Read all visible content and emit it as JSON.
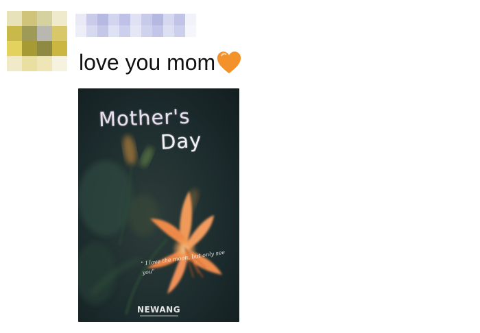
{
  "message": {
    "text": "love you mom",
    "emoji": "orange-heart-icon"
  },
  "poster": {
    "title_line1": "Mother's",
    "title_line2": "Day",
    "quote": "\" I love the moon, but only see you\"",
    "brand": "NEWANG"
  },
  "colors": {
    "heart": "#f3922a",
    "poster_bg": "#1b2a2c",
    "flower": "#f0915a"
  }
}
